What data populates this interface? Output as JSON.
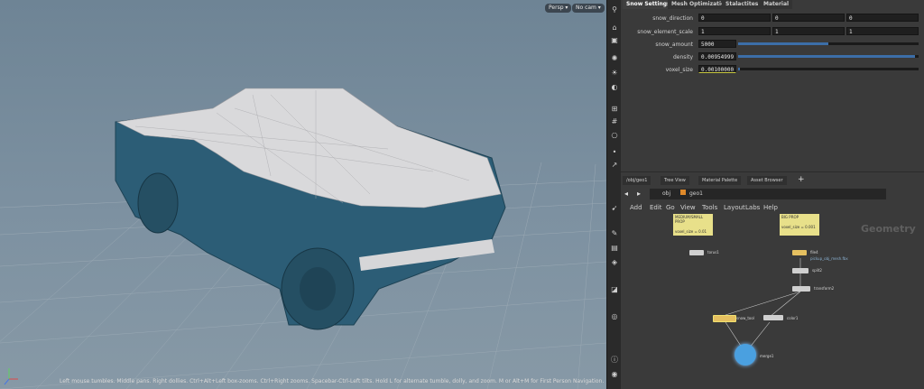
{
  "viewport": {
    "persp_label": "Persp ▾",
    "cam_label": "No cam ▾",
    "status": "Left mouse tumbles. Middle pans. Right dollies. Ctrl+Alt+Left box-zooms. Ctrl+Right zooms. Spacebar-Ctrl-Left tilts. Hold L for alternate tumble, dolly, and zoom.    M or Alt+M for First Person Navigation."
  },
  "params": {
    "tabs": [
      "Snow Settings",
      "Mesh Optimization",
      "Stalactites",
      "Material"
    ],
    "active_tab": "Snow Settings",
    "rows": [
      {
        "label": "snow_direction",
        "values": [
          "0",
          "0",
          "0"
        ]
      },
      {
        "label": "snow_element_scale",
        "values": [
          "1",
          "1",
          "1"
        ]
      },
      {
        "label": "snow_amount",
        "value": "5000",
        "slider": 0.5
      },
      {
        "label": "density",
        "value": "0.00954999",
        "slider": 0.98
      },
      {
        "label": "voxel_size",
        "value": "0.00100000",
        "slider": 0.01
      }
    ]
  },
  "network": {
    "tabs": [
      "/obj/geo1",
      "Tree View",
      "Material Palette",
      "Asset Browser"
    ],
    "path_obj": "obj",
    "path_geo": "geo1",
    "menu": [
      "Add",
      "Edit",
      "Go",
      "View",
      "Tools",
      "Layout",
      "Labs",
      "Help"
    ],
    "context_label": "Geometry",
    "sticky1": {
      "title": "MEDIUM/SMALL PROP",
      "body": "voxel_size = 0.01"
    },
    "sticky2": {
      "title": "BIG PROP",
      "body": "voxel_size = 0.001"
    },
    "nodes": {
      "torus": "torus1",
      "file": "file4",
      "file_sub": "pickup_obj_mesh.fbx",
      "split": "split2",
      "transform": "transform2",
      "snow": "snow_tool",
      "color": "color1",
      "merge": "merge1"
    }
  },
  "colors": {
    "accent": "#3c6ea8",
    "truck": "#2a5a73",
    "snow": "#d6d6d8",
    "sticky": "#e8e08a"
  }
}
